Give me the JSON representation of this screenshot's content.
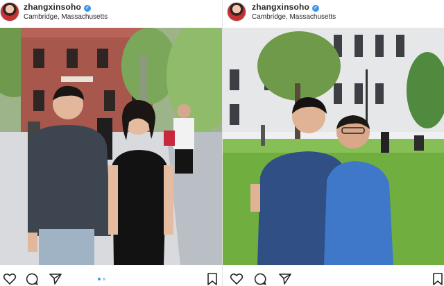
{
  "posts": [
    {
      "username": "zhangxinsoho",
      "verified_icon": "verified-badge-icon",
      "location": "Cambridge, Massachusetts",
      "photo_icon": "photo-couple-walking-campus",
      "carousel": {
        "count": 2,
        "active": 1
      }
    },
    {
      "username": "zhangxinsoho",
      "verified_icon": "verified-badge-icon",
      "location": "Cambridge, Massachusetts",
      "photo_icon": "photo-father-son-on-lawn"
    }
  ],
  "colors": {
    "accent": "#3897f0",
    "text": "#262626",
    "divider": "#e4e4e4"
  },
  "icons": [
    "heart-icon",
    "comment-icon",
    "share-icon",
    "bookmark-icon"
  ]
}
